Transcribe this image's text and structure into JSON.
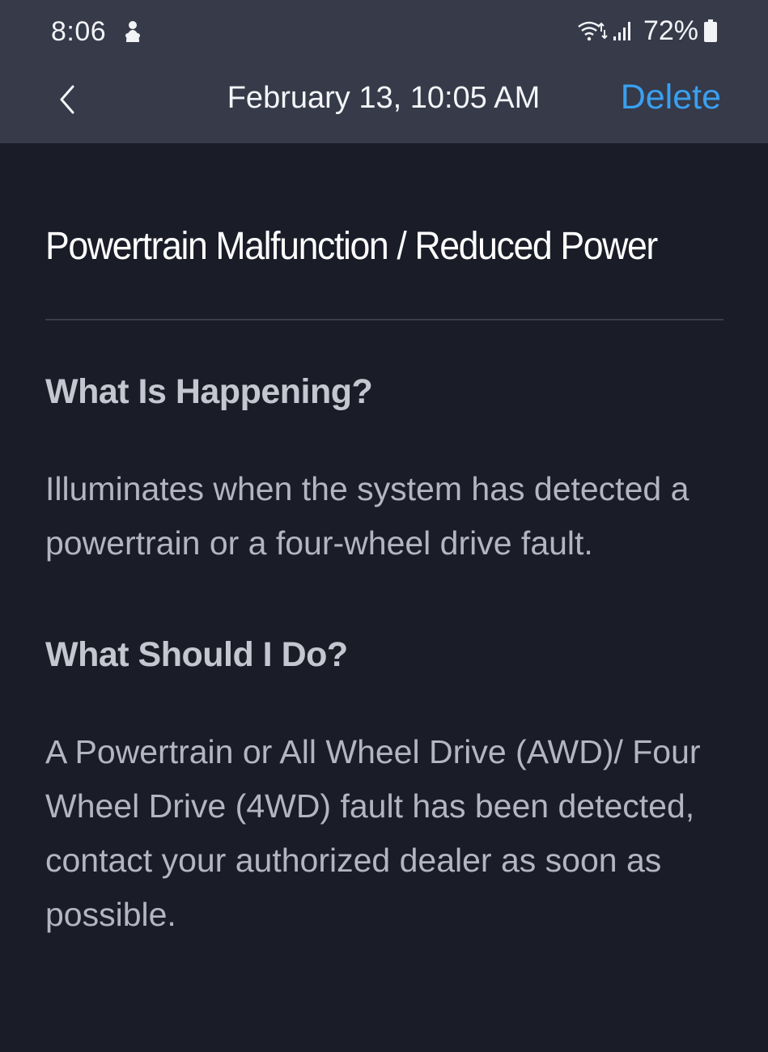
{
  "status_bar": {
    "time": "8:06",
    "battery_percent": "72%",
    "icons": {
      "notification": "notification-app-icon",
      "wifi": "wifi-icon",
      "signal": "signal-icon",
      "battery": "battery-icon"
    }
  },
  "nav": {
    "back_icon": "chevron-left-icon",
    "title": "February 13, 10:05 AM",
    "delete_label": "Delete"
  },
  "alert": {
    "title": "Powertrain Malfunction / Reduced Power",
    "sections": [
      {
        "heading": "What Is Happening?",
        "body": "Illuminates when the system has detected a powertrain or a four-wheel drive fault."
      },
      {
        "heading": "What Should I Do?",
        "body": "A Powertrain or All Wheel Drive (AWD)/ Four Wheel Drive (4WD) fault has been detected, contact your authorized dealer as soon as possible."
      }
    ]
  },
  "colors": {
    "background": "#1a1c27",
    "header": "#363a49",
    "accent": "#3aa0f0",
    "heading_text": "#c4c6d0",
    "body_text": "#b3b6c2"
  }
}
